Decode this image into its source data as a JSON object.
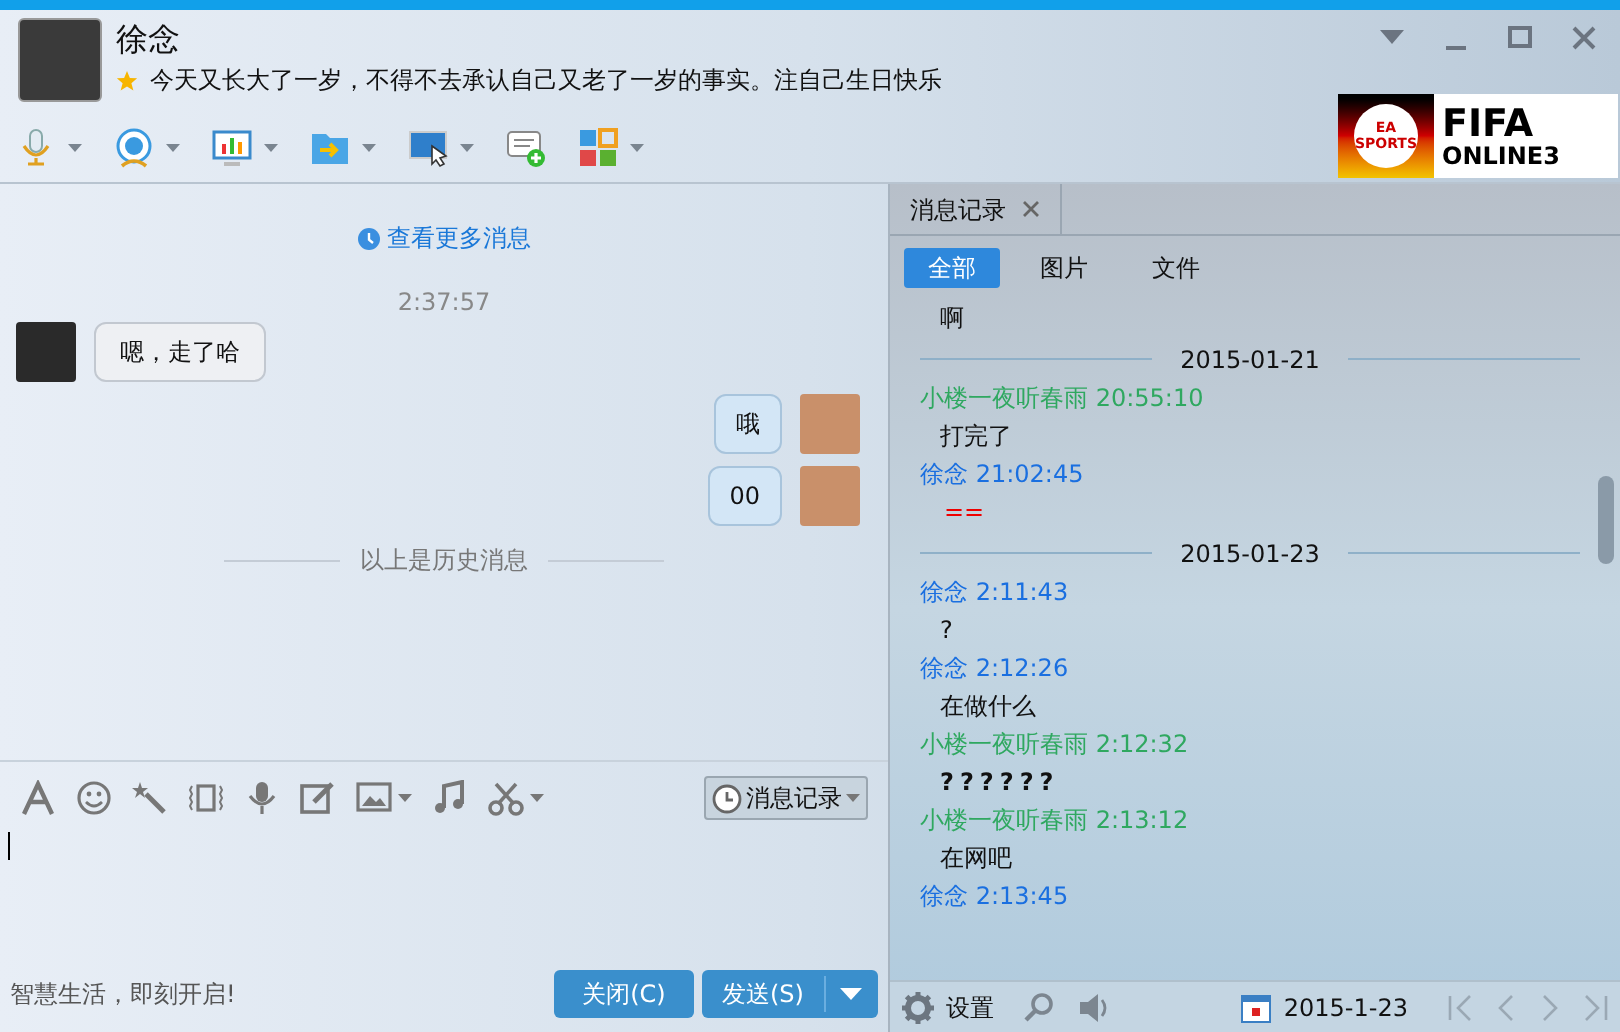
{
  "contact": {
    "name": "徐念",
    "signature": "今天又长大了一岁，不得不去承认自己又老了一岁的事实。注自己生日快乐"
  },
  "toolbar": [
    {
      "kind": "mic"
    },
    {
      "kind": "camera"
    },
    {
      "kind": "screen"
    },
    {
      "kind": "file"
    },
    {
      "kind": "remote"
    },
    {
      "kind": "invite"
    },
    {
      "kind": "apps"
    }
  ],
  "ad": {
    "brand": "EA SPORTS",
    "title": "FIFA",
    "subtitle": "ONLINE3"
  },
  "chat": {
    "more_link": "查看更多消息",
    "time": "2:37:57",
    "messages": [
      {
        "kind": "received",
        "text": "嗯，走了哈"
      },
      {
        "kind": "sent",
        "text": "哦"
      },
      {
        "kind": "sent",
        "text": "00"
      }
    ],
    "history_divider": "以上是历史消息"
  },
  "input_tools": [
    {
      "kind": "font"
    },
    {
      "kind": "emoji"
    },
    {
      "kind": "magic"
    },
    {
      "kind": "shake"
    },
    {
      "kind": "voice"
    },
    {
      "kind": "edit"
    },
    {
      "kind": "image"
    },
    {
      "kind": "music"
    },
    {
      "kind": "cut"
    }
  ],
  "history_button": "消息记录",
  "promo": "智慧生活，即刻开启!",
  "buttons": {
    "close": "关闭(C)",
    "send": "发送(S)"
  },
  "history": {
    "tab": "消息记录",
    "filters": [
      {
        "label": "全部",
        "selected": true
      },
      {
        "label": "图片",
        "selected": false
      },
      {
        "label": "文件",
        "selected": false
      }
    ],
    "entries": [
      {
        "kind": "text",
        "text": "啊"
      },
      {
        "kind": "date",
        "text": "2015-01-21"
      },
      {
        "kind": "peer",
        "text": "小楼一夜听春雨 20:55:10"
      },
      {
        "kind": "text",
        "text": "打完了"
      },
      {
        "kind": "self",
        "text": "徐念 21:02:45"
      },
      {
        "kind": "red",
        "text": "=="
      },
      {
        "kind": "date",
        "text": "2015-01-23"
      },
      {
        "kind": "self",
        "text": "徐念 2:11:43"
      },
      {
        "kind": "text",
        "text": "?"
      },
      {
        "kind": "self",
        "text": "徐念 2:12:26"
      },
      {
        "kind": "text",
        "text": "在做什么"
      },
      {
        "kind": "peer",
        "text": "小楼一夜听春雨 2:12:32"
      },
      {
        "kind": "bold",
        "text": "??????"
      },
      {
        "kind": "peer",
        "text": "小楼一夜听春雨 2:13:12"
      },
      {
        "kind": "text",
        "text": "在网吧"
      },
      {
        "kind": "self",
        "text": "徐念 2:13:45"
      }
    ],
    "settings": "设置",
    "date": "2015-1-23"
  }
}
